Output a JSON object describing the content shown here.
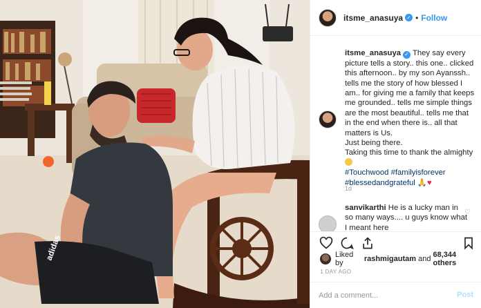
{
  "post": {
    "username": "itsme_anasuya",
    "follow_label": "Follow",
    "dot": "•",
    "caption": {
      "line1": "They say every picture tells a story.. this one.. clicked this afternoon.. by my son Ayanssh.. tells me the story of how blessed I am.. for giving me a family that keeps me grounded.. tells me simple things are the most beautiful.. tells me that in the end when there is.. all that matters is Us.",
      "line2": "Just being there.",
      "line3": "Taking this time to thank the almighty",
      "hashtags1": "#Touchwood #familyisforever",
      "hashtags2": "#blessedandgrateful",
      "emoji_end": "🙏"
    },
    "caption_age": "1d",
    "comment": {
      "username": "sanvikarthi",
      "text": "He is a lucky man in so many ways.... u guys know what I meant here"
    },
    "likes": {
      "prefix": "Liked by",
      "liker": "rashmigautam",
      "middle": "and",
      "count": "68,344 others"
    },
    "time_ago": "1 DAY AGO",
    "add_comment_placeholder": "Add a comment...",
    "post_label": "Post"
  },
  "icons": {
    "like": "heart-outline-icon",
    "comment": "comment-bubble-icon",
    "share": "share-icon",
    "save": "bookmark-icon",
    "verified": "verified-badge-icon"
  },
  "colors": {
    "link": "#3897f0",
    "hashtag": "#003569",
    "muted": "#999999"
  }
}
